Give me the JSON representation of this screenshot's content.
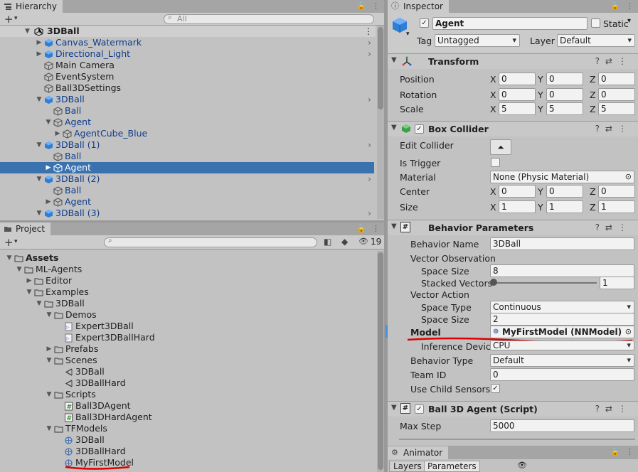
{
  "hierarchy": {
    "tab": "Hierarchy",
    "search_placeholder": "All",
    "scene": "3DBall",
    "items": [
      {
        "label": "Canvas_Watermark",
        "depth": 1,
        "blue": true,
        "arrow": "▶",
        "icon": "prefab",
        "more": true
      },
      {
        "label": "Directional_Light",
        "depth": 1,
        "blue": true,
        "arrow": "▶",
        "icon": "prefab",
        "more": true
      },
      {
        "label": "Main Camera",
        "depth": 1,
        "blue": false,
        "arrow": "",
        "icon": "gameobject",
        "more": false
      },
      {
        "label": "EventSystem",
        "depth": 1,
        "blue": false,
        "arrow": "",
        "icon": "gameobject",
        "more": false
      },
      {
        "label": "Ball3DSettings",
        "depth": 1,
        "blue": false,
        "arrow": "",
        "icon": "gameobject",
        "more": false
      },
      {
        "label": "3DBall",
        "depth": 1,
        "blue": true,
        "arrow": "▼",
        "icon": "prefab",
        "more": true
      },
      {
        "label": "Ball",
        "depth": 2,
        "blue": true,
        "arrow": "",
        "icon": "gameobject",
        "more": false
      },
      {
        "label": "Agent",
        "depth": 2,
        "blue": true,
        "arrow": "▼",
        "icon": "gameobject",
        "more": false
      },
      {
        "label": "AgentCube_Blue",
        "depth": 3,
        "blue": true,
        "arrow": "▶",
        "icon": "gameobject",
        "more": false
      },
      {
        "label": "3DBall (1)",
        "depth": 1,
        "blue": true,
        "arrow": "▼",
        "icon": "prefab",
        "more": true
      },
      {
        "label": "Ball",
        "depth": 2,
        "blue": true,
        "arrow": "",
        "icon": "gameobject",
        "more": false
      },
      {
        "label": "Agent",
        "depth": 2,
        "blue": true,
        "arrow": "▶",
        "icon": "gameobject",
        "more": false,
        "selected": true
      },
      {
        "label": "3DBall (2)",
        "depth": 1,
        "blue": true,
        "arrow": "▼",
        "icon": "prefab",
        "more": true
      },
      {
        "label": "Ball",
        "depth": 2,
        "blue": true,
        "arrow": "",
        "icon": "gameobject",
        "more": false
      },
      {
        "label": "Agent",
        "depth": 2,
        "blue": true,
        "arrow": "▶",
        "icon": "gameobject",
        "more": false
      },
      {
        "label": "3DBall (3)",
        "depth": 1,
        "blue": true,
        "arrow": "▼",
        "icon": "prefab",
        "more": true
      }
    ]
  },
  "project": {
    "tab": "Project",
    "count": "19",
    "items": [
      {
        "label": "Assets",
        "depth": 0,
        "arrow": "▼",
        "icon": "folder",
        "bold": true
      },
      {
        "label": "ML-Agents",
        "depth": 1,
        "arrow": "▼",
        "icon": "folder"
      },
      {
        "label": "Editor",
        "depth": 2,
        "arrow": "▶",
        "icon": "folder"
      },
      {
        "label": "Examples",
        "depth": 2,
        "arrow": "▼",
        "icon": "folder"
      },
      {
        "label": "3DBall",
        "depth": 3,
        "arrow": "▼",
        "icon": "folder"
      },
      {
        "label": "Demos",
        "depth": 4,
        "arrow": "▼",
        "icon": "folder"
      },
      {
        "label": "Expert3DBall",
        "depth": 5,
        "arrow": "",
        "icon": "demo"
      },
      {
        "label": "Expert3DBallHard",
        "depth": 5,
        "arrow": "",
        "icon": "demo"
      },
      {
        "label": "Prefabs",
        "depth": 4,
        "arrow": "▶",
        "icon": "folder"
      },
      {
        "label": "Scenes",
        "depth": 4,
        "arrow": "▼",
        "icon": "folder"
      },
      {
        "label": "3DBall",
        "depth": 5,
        "arrow": "",
        "icon": "scene"
      },
      {
        "label": "3DBallHard",
        "depth": 5,
        "arrow": "",
        "icon": "scene"
      },
      {
        "label": "Scripts",
        "depth": 4,
        "arrow": "▼",
        "icon": "folder"
      },
      {
        "label": "Ball3DAgent",
        "depth": 5,
        "arrow": "",
        "icon": "script"
      },
      {
        "label": "Ball3DHardAgent",
        "depth": 5,
        "arrow": "",
        "icon": "script"
      },
      {
        "label": "TFModels",
        "depth": 4,
        "arrow": "▼",
        "icon": "folder"
      },
      {
        "label": "3DBall",
        "depth": 5,
        "arrow": "",
        "icon": "model"
      },
      {
        "label": "3DBallHard",
        "depth": 5,
        "arrow": "",
        "icon": "model"
      },
      {
        "label": "MyFirstModel",
        "depth": 5,
        "arrow": "",
        "icon": "model",
        "underlined": true
      }
    ]
  },
  "inspector": {
    "tab": "Inspector",
    "name": "Agent",
    "static_label": "Static",
    "tag_label": "Tag",
    "tag": "Untagged",
    "layer_label": "Layer",
    "layer": "Default",
    "transform": {
      "title": "Transform",
      "position_label": "Position",
      "rotation_label": "Rotation",
      "scale_label": "Scale",
      "position": [
        "0",
        "0",
        "0"
      ],
      "rotation": [
        "0",
        "0",
        "0"
      ],
      "scale": [
        "5",
        "5",
        "5"
      ]
    },
    "box_collider": {
      "title": "Box Collider",
      "edit_label": "Edit Collider",
      "trigger_label": "Is Trigger",
      "material_label": "Material",
      "material": "None (Physic Material)",
      "center_label": "Center",
      "size_label": "Size",
      "center": [
        "0",
        "0",
        "0"
      ],
      "size": [
        "1",
        "1",
        "1"
      ]
    },
    "behavior": {
      "title": "Behavior Parameters",
      "name_label": "Behavior Name",
      "name": "3DBall",
      "vector_obs_label": "Vector Observation",
      "space_size_label": "Space Size",
      "obs_size": "8",
      "stacked_label": "Stacked Vectors",
      "stacked": "1",
      "stacked_fraction": 0.0,
      "vector_action_label": "Vector Action",
      "space_type_label": "Space Type",
      "space_type": "Continuous",
      "action_size": "2",
      "model_label": "Model",
      "model": "MyFirstModel (NNModel)",
      "inference_label": "Inference Device",
      "inference": "CPU",
      "btype_label": "Behavior Type",
      "btype": "Default",
      "team_label": "Team ID",
      "team": "0",
      "child_label": "Use Child Sensors"
    },
    "agent_script": {
      "title": "Ball 3D Agent (Script)",
      "max_step_label": "Max Step",
      "max_step": "5000"
    },
    "axis": [
      "X",
      "Y",
      "Z"
    ]
  },
  "animator": {
    "tab": "Animator",
    "layers": "Layers",
    "parameters": "Parameters"
  },
  "colors": {
    "selection": "#3a72b0",
    "prefab_blue": "#0e3c8c",
    "annotation_red": "#e00000"
  }
}
